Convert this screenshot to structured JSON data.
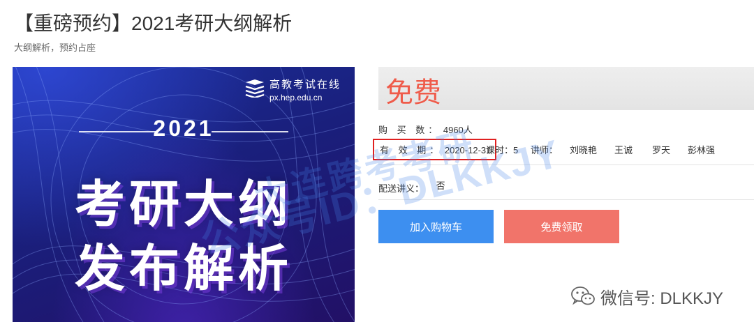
{
  "page": {
    "title": "【重磅预约】2021考研大纲解析",
    "subtitle": "大纲解析，预约占座"
  },
  "banner": {
    "logo_cn": "高教考试在线",
    "logo_url": "px.hep.edu.cn",
    "year": "2021",
    "line1": "考研大纲",
    "line2": "发布解析"
  },
  "price": {
    "label": "免费"
  },
  "stats": {
    "buy_label": "购 买 数：",
    "buy_count": "4960人",
    "valid_label": "有 效 期：",
    "valid_date": "2020-12-31",
    "hours_label": "课时：",
    "hours_value": "5",
    "lecturer_label": "讲师：",
    "lecturers": [
      "刘晓艳",
      "王诚",
      "罗天",
      "彭林强"
    ]
  },
  "shipping": {
    "label": "配送讲义：",
    "value": "否"
  },
  "buttons": {
    "add_cart": "加入购物车",
    "get_free": "免费领取"
  },
  "watermark": {
    "line1": "大连跨考考研",
    "line2": "公众号ID：DLKKJY"
  },
  "footer": {
    "wechat_label": "微信号: DLKKJY"
  },
  "colors": {
    "price": "#ef5b4a",
    "cart_button": "#3d8ff0",
    "free_button": "#f1746a",
    "highlight_box": "#e02020"
  }
}
